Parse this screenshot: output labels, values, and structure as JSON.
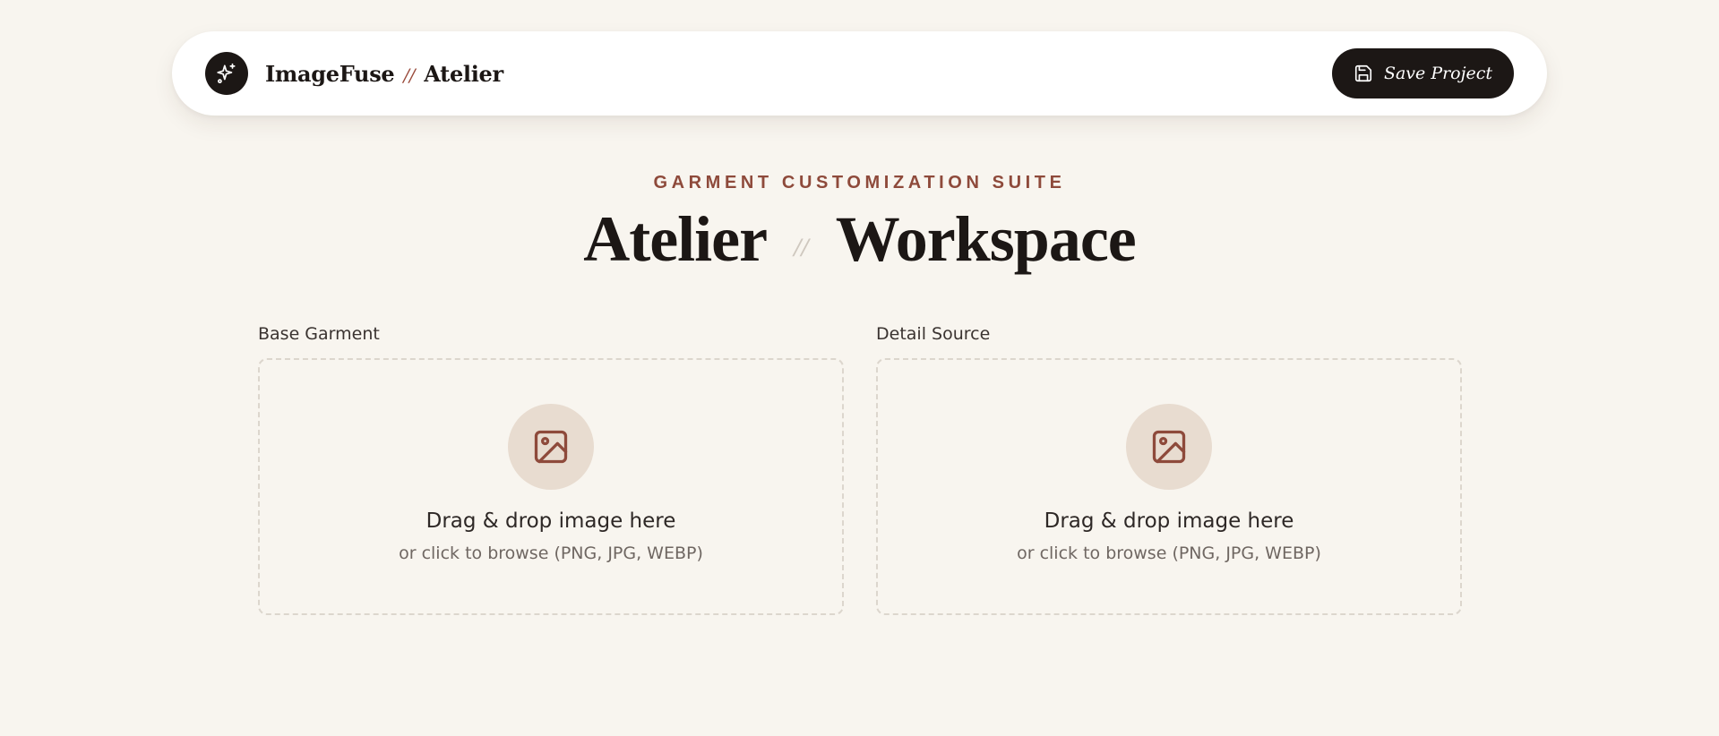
{
  "header": {
    "brand_name": "ImageFuse",
    "brand_separator": "//",
    "brand_product": "Atelier",
    "logo_icon": "sparkles-icon",
    "save_icon": "floppy-disk-icon",
    "save_label": "Save Project"
  },
  "hero": {
    "eyebrow": "GARMENT CUSTOMIZATION SUITE",
    "title_left": "Atelier",
    "title_separator": "//",
    "title_right": "Workspace"
  },
  "uploads": [
    {
      "label": "Base Garment",
      "icon": "image-icon",
      "title": "Drag & drop image here",
      "subtitle": "or click to browse (PNG, JPG, WEBP)"
    },
    {
      "label": "Detail Source",
      "icon": "image-icon",
      "title": "Drag & drop image here",
      "subtitle": "or click to browse (PNG, JPG, WEBP)"
    }
  ],
  "colors": {
    "background": "#f8f5ef",
    "ink": "#1c1715",
    "accent": "#8e4a3b",
    "icon_circle": "#e8dcd0",
    "dashed_border": "#dcd6cd"
  }
}
